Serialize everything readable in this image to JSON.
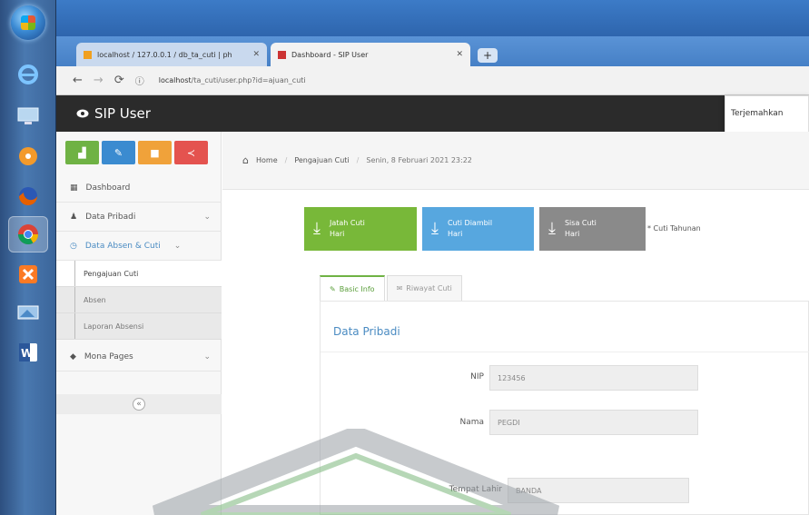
{
  "taskbar": {
    "icons": [
      "windows-orb",
      "internet-explorer-icon",
      "desktop-icon",
      "media-player-icon",
      "firefox-icon",
      "chrome-icon",
      "xampp-icon",
      "remote-desktop-icon",
      "word-icon"
    ]
  },
  "browser": {
    "tabs": [
      {
        "label": "localhost / 127.0.0.1 / db_ta_cuti | ph",
        "state": "inactive"
      },
      {
        "label": "Dashboard - SIP User",
        "state": "active"
      }
    ],
    "new_tab": "+",
    "url_host": "localhost",
    "url_path": "/ta_cuti/user.php?id=ajuan_cuti"
  },
  "app": {
    "brand": "SIP User",
    "popup_text": "Terjemahkan"
  },
  "sidebar": {
    "button_colors": [
      "#6fb244",
      "#3b8bd0",
      "#f0a23a",
      "#e4534f"
    ],
    "items": [
      {
        "label": "Dashboard",
        "icon": "dashboard-icon"
      },
      {
        "label": "Data Pribadi",
        "icon": "user-icon"
      },
      {
        "label": "Data Absen & Cuti",
        "icon": "clock-icon"
      },
      {
        "label": "Mona Pages",
        "icon": "tag-icon"
      }
    ],
    "subitems": [
      {
        "label": "Pengajuan Cuti",
        "active": true
      },
      {
        "label": "Absen",
        "active": false
      },
      {
        "label": "Laporan Absensi",
        "active": false
      }
    ]
  },
  "main": {
    "breadcrumb": {
      "home": "Home",
      "section": "Pengajuan Cuti",
      "current": "Senin, 8 Februari 2021 23:22"
    },
    "actions": [
      {
        "title": "Jatah Cuti",
        "sub": "Hari",
        "color": "#78b839"
      },
      {
        "title": "Cuti Diambil",
        "sub": "Hari",
        "color": "#57a7df"
      },
      {
        "title": "Sisa Cuti",
        "sub": "Hari",
        "color": "#8a8a8a"
      }
    ],
    "note": "* Cuti Tahunan",
    "tabs": [
      {
        "label": "Basic Info",
        "state": "active"
      },
      {
        "label": "Riwayat Cuti",
        "state": "inactive"
      }
    ],
    "panel_title": "Data Pribadi",
    "fields": [
      {
        "label": "NIP",
        "value": "123456"
      },
      {
        "label": "Nama",
        "value": "PEGDI"
      },
      {
        "label": "Tempat Lahir",
        "value": "BANDA"
      }
    ]
  }
}
